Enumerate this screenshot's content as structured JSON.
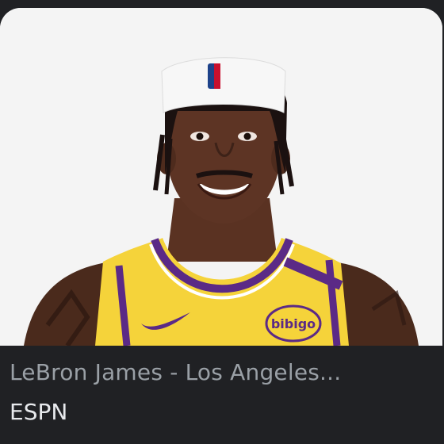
{
  "result": {
    "title": "LeBron James - Los Angeles...",
    "source": "ESPN"
  },
  "image": {
    "jersey_sponsor": "bibigo",
    "jersey_color": "#f5d33a",
    "trim_color": "#5b2a86",
    "headband_color": "#f7f7f7"
  }
}
